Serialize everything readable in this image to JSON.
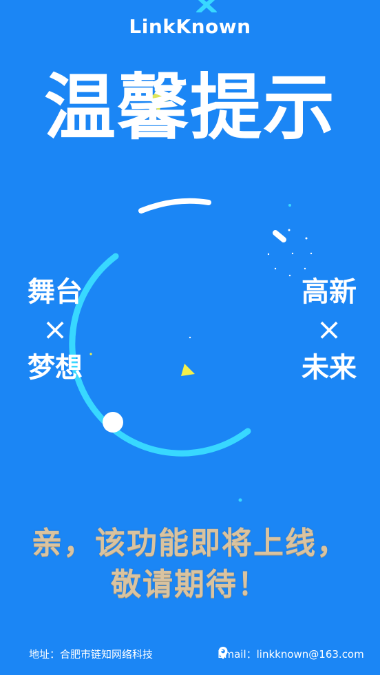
{
  "brand": "LinkKnown",
  "headline": "温馨提示",
  "left_group": {
    "top": "舞台",
    "cross": "×",
    "bottom": "梦想"
  },
  "right_group": {
    "top": "高新",
    "cross": "×",
    "bottom": "未来"
  },
  "message": {
    "line1": "亲，该功能即将上线，",
    "line2": "敬请期待！"
  },
  "footer": {
    "address": "地址：合肥市链知网络科技",
    "email": "Email：linkknown@163.com"
  },
  "colors": {
    "background": "#1b86f5",
    "accent_cyan": "#38d8ff",
    "accent_yellow": "#f4f04a",
    "message_gold": "#d9c3a0"
  },
  "icons": [
    "cross-decoration-icon",
    "location-pin-icon",
    "triangle-decoration-icon"
  ]
}
